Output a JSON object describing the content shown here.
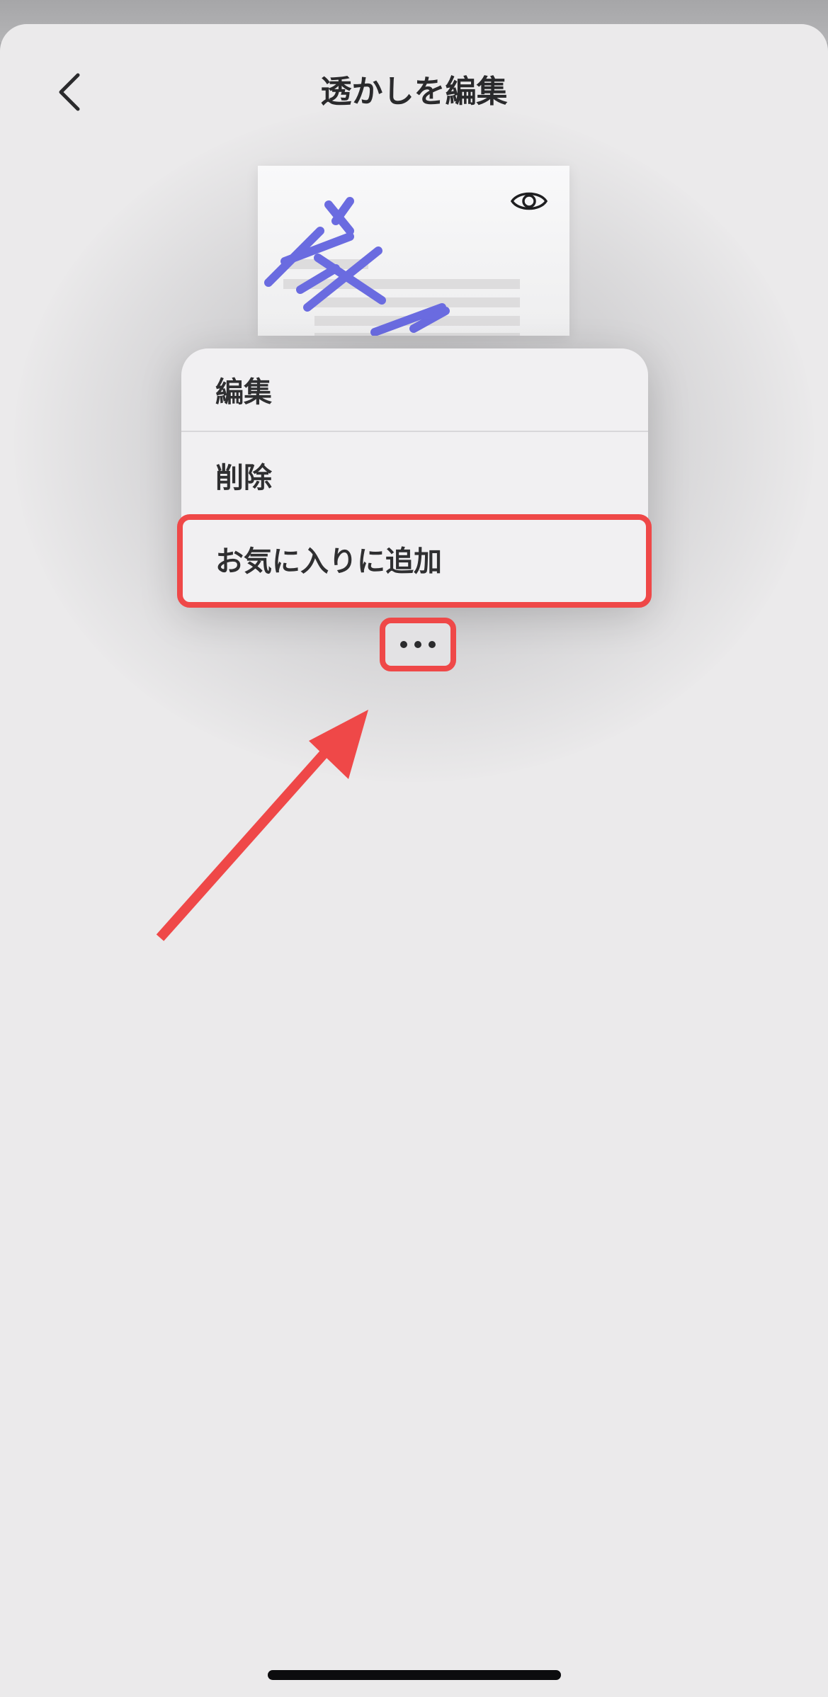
{
  "header": {
    "title": "透かしを編集"
  },
  "context_menu": {
    "items": [
      {
        "label": "編集"
      },
      {
        "label": "削除"
      },
      {
        "label": "お気に入りに追加"
      }
    ]
  },
  "icons": {
    "back": "chevron-left-icon",
    "preview": "eye-icon",
    "more": "ellipsis-icon"
  },
  "colors": {
    "sheet_background": "#ebeaeb",
    "menu_background": "#f1f0f2",
    "watermark_accent": "#6a6be0",
    "annotation_red": "#ef4848",
    "text_primary": "#2a2a2c"
  }
}
